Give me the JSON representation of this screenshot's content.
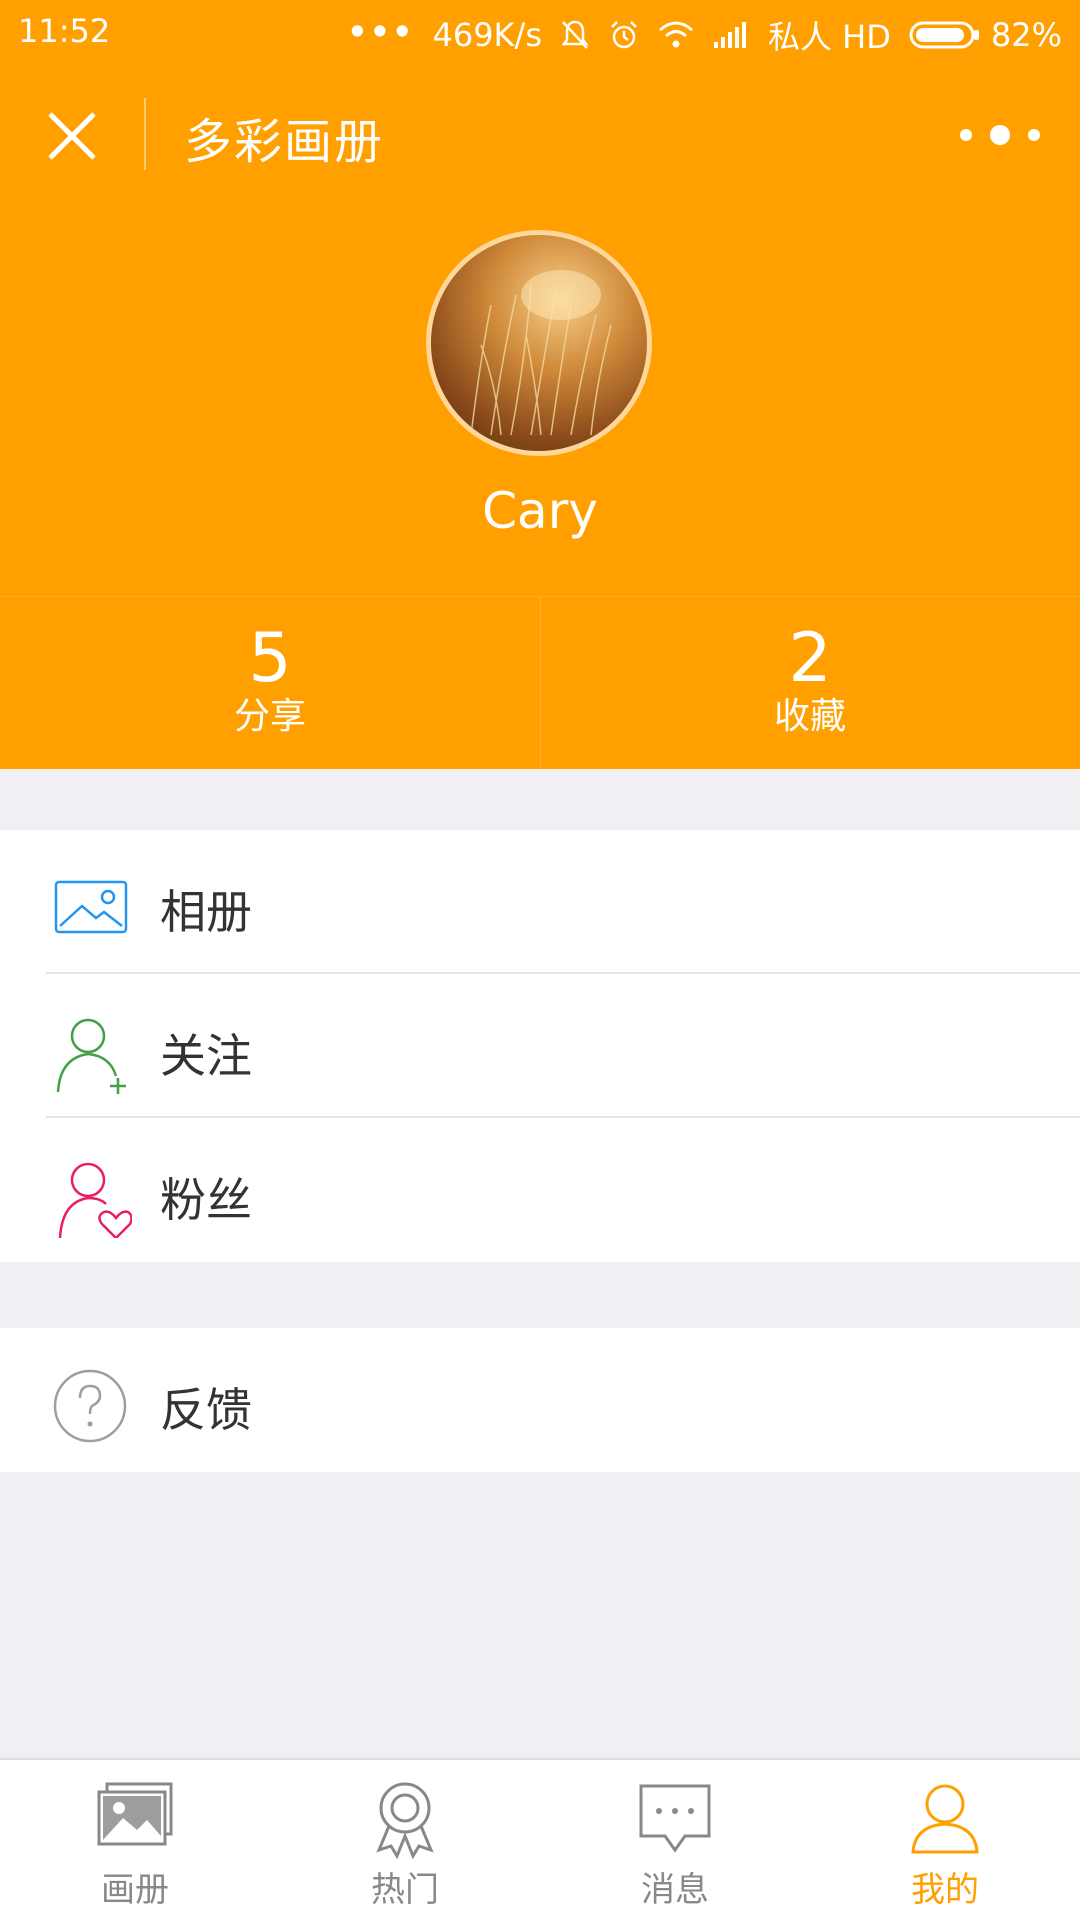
{
  "status_bar": {
    "time": "11:52",
    "dots": "•••",
    "network_speed": "469K/s",
    "carrier": "私人 HD",
    "battery": "82%"
  },
  "nav": {
    "title": "多彩画册"
  },
  "profile": {
    "username": "Cary"
  },
  "stats": [
    {
      "value": "5",
      "label": "分享"
    },
    {
      "value": "2",
      "label": "收藏"
    }
  ],
  "menu": [
    {
      "label": "相册",
      "icon": "album-icon"
    },
    {
      "label": "关注",
      "icon": "follow-user-icon"
    },
    {
      "label": "粉丝",
      "icon": "fans-heart-icon"
    }
  ],
  "menu2": [
    {
      "label": "反馈",
      "icon": "help-question-icon"
    }
  ],
  "tabs": [
    {
      "label": "画册",
      "icon": "photo-album-icon"
    },
    {
      "label": "热门",
      "icon": "award-badge-icon"
    },
    {
      "label": "消息",
      "icon": "message-bubble-icon"
    },
    {
      "label": "我的",
      "icon": "person-icon"
    }
  ],
  "colors": {
    "accent": "#ffa000",
    "album_icon": "#2196f3",
    "follow_icon": "#43a047",
    "fans_icon": "#e91e63",
    "help_icon": "#9e9e9e"
  }
}
